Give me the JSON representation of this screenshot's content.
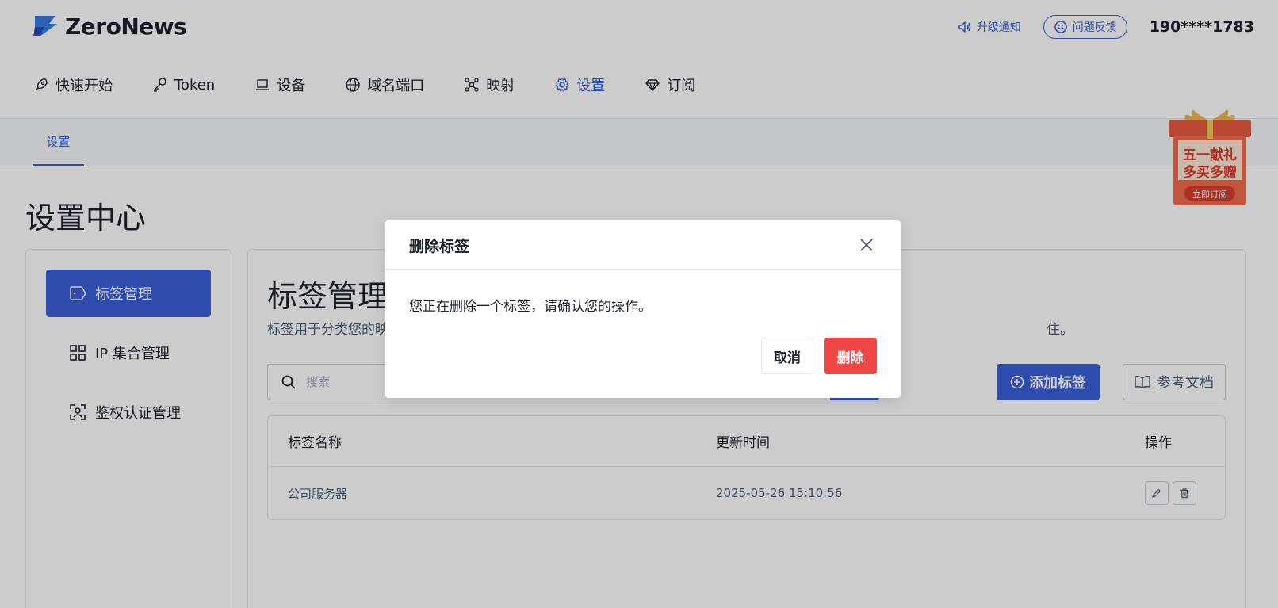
{
  "header": {
    "logo_text": "ZeroNews",
    "notice_label": "升级通知",
    "feedback_label": "问题反馈",
    "user_phone": "190****1783"
  },
  "nav": {
    "items": [
      {
        "label": "快速开始",
        "icon": "rocket-icon"
      },
      {
        "label": "Token",
        "icon": "key-icon"
      },
      {
        "label": "设备",
        "icon": "laptop-icon"
      },
      {
        "label": "域名端口",
        "icon": "globe-icon"
      },
      {
        "label": "映射",
        "icon": "network-icon"
      },
      {
        "label": "设置",
        "icon": "gear-icon",
        "active": true
      },
      {
        "label": "订阅",
        "icon": "diamond-icon"
      }
    ]
  },
  "subnav": {
    "tab_label": "设置"
  },
  "page": {
    "title": "设置中心"
  },
  "sidebar": {
    "items": [
      {
        "label": "标签管理",
        "icon": "tag-icon",
        "active": true
      },
      {
        "label": "IP 集合管理",
        "icon": "grid-icon"
      },
      {
        "label": "鉴权认证管理",
        "icon": "face-scan-icon"
      }
    ]
  },
  "main": {
    "title": "标签管理",
    "description_start": "标签用于分类您的映",
    "description_end": "住。",
    "search_placeholder": "搜索",
    "add_label": "添加标签",
    "doc_label": "参考文档",
    "table": {
      "columns": [
        "标签名称",
        "更新时间",
        "操作"
      ],
      "rows": [
        {
          "name": "公司服务器",
          "updated": "2025-05-26 15:10:56"
        }
      ]
    }
  },
  "promo": {
    "line1": "五一献礼",
    "line2": "多买多赠",
    "cta": "立即订阅"
  },
  "modal": {
    "title": "删除标签",
    "message": "您正在删除一个标签，请确认您的操作。",
    "cancel_label": "取消",
    "delete_label": "删除"
  },
  "colors": {
    "primary": "#3a5fd8",
    "danger": "#f04646",
    "overlay": "rgba(0,0,0,0.2)"
  }
}
